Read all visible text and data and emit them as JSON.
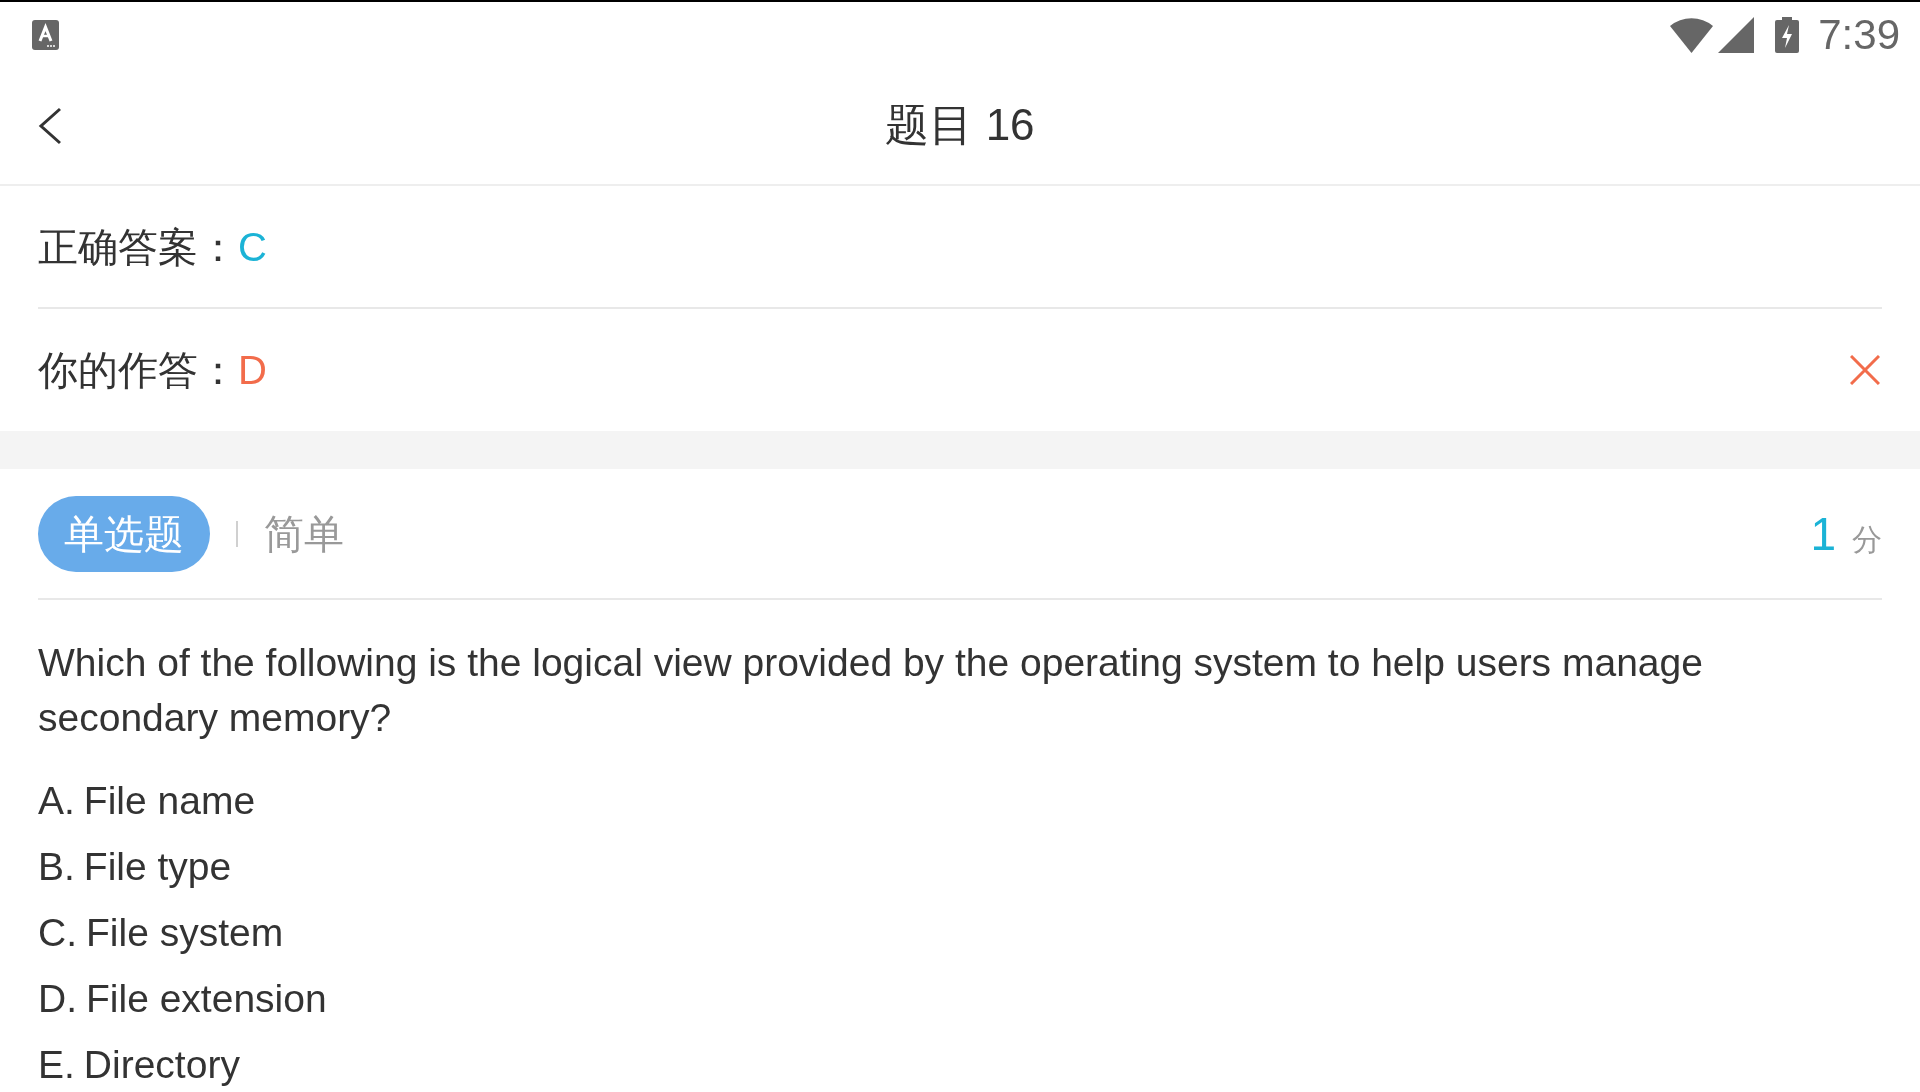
{
  "status_bar": {
    "time": "7:39"
  },
  "header": {
    "title": "题目 16"
  },
  "correct_answer": {
    "label": "正确答案：",
    "value": "C"
  },
  "your_answer": {
    "label": "你的作答：",
    "value": "D",
    "correct": false
  },
  "question": {
    "type": "单选题",
    "difficulty": "简单",
    "score": "1",
    "score_unit": "分",
    "text": "Which of the following is the logical view provided by the operating system to help users manage secondary memory?",
    "options": [
      {
        "letter": "A.",
        "text": "File name"
      },
      {
        "letter": "B.",
        "text": "File type"
      },
      {
        "letter": "C.",
        "text": "File system"
      },
      {
        "letter": "D.",
        "text": "File extension"
      },
      {
        "letter": "E.",
        "text": "Directory"
      }
    ]
  }
}
